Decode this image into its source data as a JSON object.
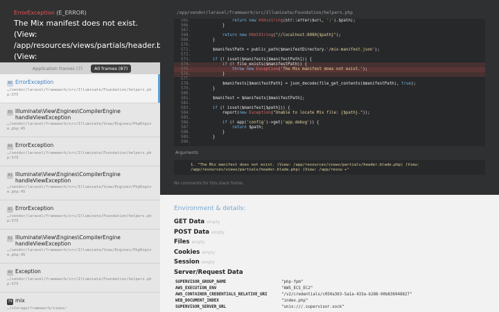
{
  "exception": {
    "type": "ErrorException",
    "level": "(E_ERROR)",
    "message": "The Mix manifest does not exist. (View: /app/resources/views/partials/header.blade.php) (View: /app/resources/views/partials/header.blade.php) (View: /app/resources/views/partials/header.blade.php)"
  },
  "frame_tabs": {
    "application": "Application frames (7)",
    "all": "All frames (87)"
  },
  "frames": [
    {
      "index": "86",
      "class": "ErrorException",
      "file": "…/vendor/laravel/framework/src/Illuminate/Foundation/helpers.php:575"
    },
    {
      "index": "85",
      "class": "Illuminate\\View\\Engines\\CompilerEngine handleViewException",
      "file": "…/vendor/laravel/framework/src/Illuminate/View/Engines/PhpEngine.php:45"
    },
    {
      "index": "84",
      "class": "ErrorException",
      "file": "…/vendor/laravel/framework/src/Illuminate/Foundation/helpers.php:575"
    },
    {
      "index": "83",
      "class": "Illuminate\\View\\Engines\\CompilerEngine handleViewException",
      "file": "…/vendor/laravel/framework/src/Illuminate/View/Engines/PhpEngine.php:45"
    },
    {
      "index": "82",
      "class": "ErrorException",
      "file": "…/vendor/laravel/framework/src/Illuminate/Foundation/helpers.php:575"
    },
    {
      "index": "81",
      "class": "Illuminate\\View\\Engines\\CompilerEngine handleViewException",
      "file": "…/vendor/laravel/framework/src/Illuminate/View/Engines/PhpEngine.php:45"
    },
    {
      "index": "80",
      "class": "Exception",
      "file": "…/vendor/laravel/framework/src/Illuminate/Foundation/helpers.php:575"
    },
    {
      "index": "79",
      "class": "mix",
      "file": "…/storage/framework/views/"
    }
  ],
  "code": {
    "file_path": "/app/vendor/laravel/framework/src/Illuminate/Foundation/helpers.php",
    "lines": [
      {
        "n": "565.",
        "t": "                return new HtmlString(Str::after($url, ':').$path);"
      },
      {
        "n": "566.",
        "t": "            }"
      },
      {
        "n": "567.",
        "t": ""
      },
      {
        "n": "568.",
        "t": "            return new HtmlString(\"//localhost:8080{$path}\");"
      },
      {
        "n": "569.",
        "t": "        }"
      },
      {
        "n": "570.",
        "t": ""
      },
      {
        "n": "571.",
        "t": "        $manifestPath = public_path($manifestDirectory.'/mix-manifest.json');"
      },
      {
        "n": "572.",
        "t": ""
      },
      {
        "n": "573.",
        "t": "        if (! isset($manifests[$manifestPath])) {"
      },
      {
        "n": "574.",
        "t": "            if (! file_exists($manifestPath)) {"
      },
      {
        "n": "575.",
        "t": "                throw new Exception('The Mix manifest does not exist.');"
      },
      {
        "n": "576.",
        "t": "            }"
      },
      {
        "n": "577.",
        "t": ""
      },
      {
        "n": "578.",
        "t": "            $manifests[$manifestPath] = json_decode(file_get_contents($manifestPath), true);"
      },
      {
        "n": "579.",
        "t": "        }"
      },
      {
        "n": "580.",
        "t": ""
      },
      {
        "n": "581.",
        "t": "        $manifest = $manifests[$manifestPath];"
      },
      {
        "n": "582.",
        "t": ""
      },
      {
        "n": "583.",
        "t": "        if (! isset($manifest[$path])) {"
      },
      {
        "n": "584.",
        "t": "            report(new Exception(\"Unable to locate Mix file: {$path}.\"));"
      },
      {
        "n": "585.",
        "t": ""
      },
      {
        "n": "586.",
        "t": "            if (! app('config')->get('app.debug')) {"
      },
      {
        "n": "587.",
        "t": "                return $path;"
      },
      {
        "n": "588.",
        "t": "            }"
      },
      {
        "n": "589.",
        "t": "        }"
      },
      {
        "n": "590.",
        "t": ""
      }
    ],
    "highlight_line": "575."
  },
  "arguments": {
    "label": "Arguments",
    "value": "1. \"The Mix manifest does not exist. (View: /app/resources/views/partials/header.blade.php) (View: /app/resources/views/partials/header.blade.php) (View: /app/resou ▸\""
  },
  "no_comments": "No comments for this stack frame.",
  "environment": {
    "title": "Environment & details:",
    "sections": [
      {
        "name": "GET Data",
        "empty": "empty"
      },
      {
        "name": "POST Data",
        "empty": "empty"
      },
      {
        "name": "Files",
        "empty": "empty"
      },
      {
        "name": "Cookies",
        "empty": "empty"
      },
      {
        "name": "Session",
        "empty": "empty"
      },
      {
        "name": "Server/Request Data",
        "empty": ""
      }
    ],
    "server": [
      {
        "k": "SUPERVISOR_GROUP_NAME",
        "v": "\"php-fpm\""
      },
      {
        "k": "AWS_EXECUTION_ENV",
        "v": "\"AWS_ECS_EC2\""
      },
      {
        "k": "AWS_CONTAINER_CREDENTIALS_RELATIVE_URI",
        "v": "\"/v2/credentials/c050a363-5a1a-433a-b288-00b836948827\""
      },
      {
        "k": "WEB_DOCUMENT_INDEX",
        "v": "\"index.php\""
      },
      {
        "k": "SUPERVISOR_SERVER_URL",
        "v": "\"unix:///.supervisor.sock\""
      }
    ]
  }
}
